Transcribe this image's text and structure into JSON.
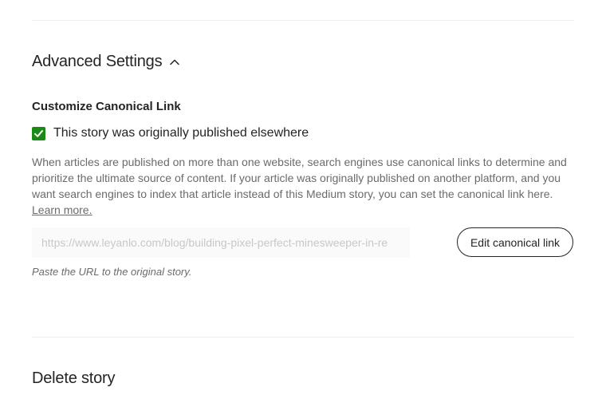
{
  "advanced_settings": {
    "title": "Advanced Settings",
    "toggle_icon": "chevron-up-icon",
    "expanded": true
  },
  "canonical": {
    "heading": "Customize Canonical Link",
    "checkbox_label": "This story was originally published elsewhere",
    "checkbox_checked": true,
    "description": "When articles are published on more than one website, search engines use canonical links to determine and prioritize the ultimate source of content. If your article was originally published on another platform, and you want search engines to index that article instead of this Medium story, you can set the canonical link here.",
    "learn_more_label": "Learn more.",
    "url_placeholder": "https://www.leyanlo.com/blog/building-pixel-perfect-minesweeper-in-re",
    "url_value": "",
    "edit_button_label": "Edit canonical link",
    "helper_text": "Paste the URL to the original story."
  },
  "delete": {
    "title": "Delete story"
  },
  "colors": {
    "checkbox_green": "#1a8917",
    "text_primary": "#242424",
    "text_secondary": "#6b6b6b"
  }
}
